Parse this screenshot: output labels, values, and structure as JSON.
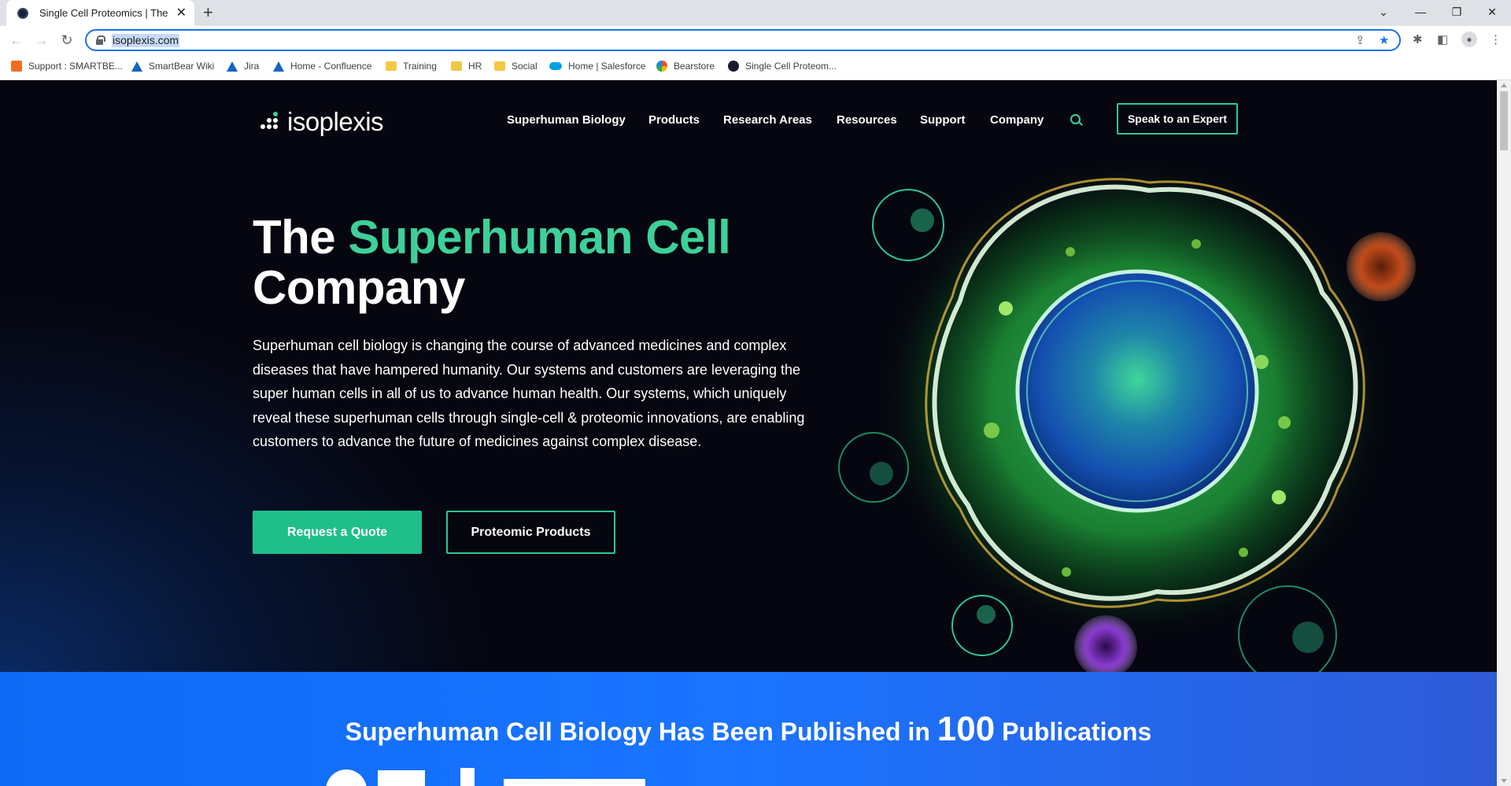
{
  "browser": {
    "tab_title": "Single Cell Proteomics | The Superhuman Cell Company",
    "url": "isoplexis.com",
    "bookmarks": [
      {
        "label": "Support : SMARTBE...",
        "icon": "smartbear-icon"
      },
      {
        "label": "SmartBear Wiki",
        "icon": "atlassian-icon"
      },
      {
        "label": "Jira",
        "icon": "atlassian-icon"
      },
      {
        "label": "Home - Confluence",
        "icon": "atlassian-icon"
      },
      {
        "label": "Training",
        "icon": "folder-icon"
      },
      {
        "label": "HR",
        "icon": "folder-icon"
      },
      {
        "label": "Social",
        "icon": "folder-icon"
      },
      {
        "label": "Home | Salesforce",
        "icon": "salesforce-icon"
      },
      {
        "label": "Bearstore",
        "icon": "bearstore-icon"
      },
      {
        "label": "Single Cell Proteom...",
        "icon": "isoplexis-icon"
      }
    ]
  },
  "site": {
    "logo_text": "isoplexis",
    "nav": [
      "Superhuman Biology",
      "Products",
      "Research Areas",
      "Resources",
      "Support",
      "Company"
    ],
    "cta_expert": "Speak to an Expert"
  },
  "hero": {
    "title_lead": "The ",
    "title_accent": "Superhuman Cell",
    "title_tail": "Company",
    "body": "Superhuman cell biology is changing the course of advanced medicines and complex diseases that have hampered humanity. Our systems and customers are leveraging the super human cells in all of us to advance human health. Our systems, which uniquely reveal these superhuman cells through single-cell & proteomic innovations, are enabling customers to advance the future of medicines against complex disease.",
    "btn_quote": "Request a Quote",
    "btn_products": "Proteomic Products"
  },
  "band": {
    "title_lead": "Superhuman Cell Biology Has Been Published in ",
    "count": "100",
    "title_tail": " Publications"
  },
  "colors": {
    "accent": "#3ed09a",
    "hero_bg": "#05060f",
    "band_bg": "#1a74ff",
    "button_fill": "#1fbf8a"
  }
}
